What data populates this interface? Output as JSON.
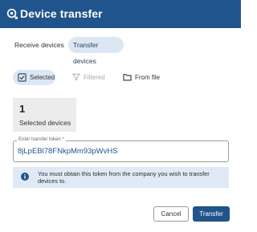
{
  "header": {
    "title": "Device transfer",
    "icon": "device-transfer-icon"
  },
  "tabs": [
    {
      "label": "Receive devices",
      "active": false
    },
    {
      "label": "Transfer devices",
      "active": true
    }
  ],
  "filters": [
    {
      "label": "Selected",
      "icon": "checklist-icon",
      "active": true
    },
    {
      "label": "Filtered",
      "icon": "filter-icon",
      "active": false,
      "disabled": true
    },
    {
      "label": "From file",
      "icon": "folder-icon",
      "active": false
    }
  ],
  "summary": {
    "count": "1",
    "caption": "Selected devices"
  },
  "token_field": {
    "label": "Enter transfer token *",
    "value": "8jLpEBl78FNkpMm93pWvHS"
  },
  "info": {
    "text": "You must obtain this token from the company you wish to transfer devices to.",
    "icon": "info-icon"
  },
  "actions": {
    "cancel": "Cancel",
    "transfer": "Transfer"
  },
  "colors": {
    "primary": "#20548c",
    "tab_active": "#dce7f4",
    "info_bg": "#dfeaf6",
    "card_bg": "#ececec"
  }
}
